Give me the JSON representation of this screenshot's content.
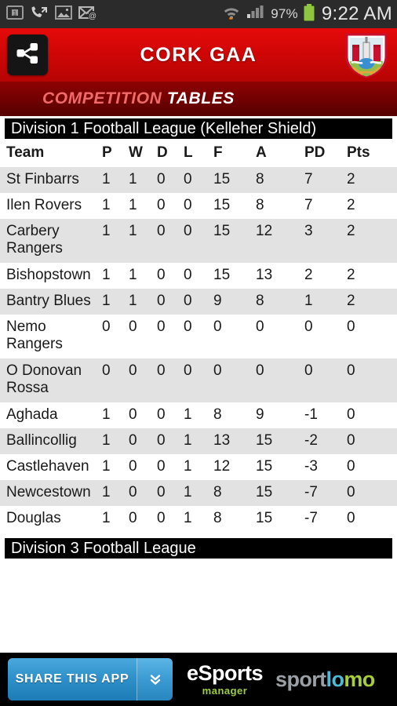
{
  "statusbar": {
    "icons": [
      "sim-card-icon",
      "missed-call-icon",
      "screenshot-icon",
      "email-icon"
    ],
    "wifi_icon": "wifi-icon",
    "signal_icon": "cell-signal-icon",
    "battery_percent": "97%",
    "battery_icon": "battery-full-icon",
    "clock": "9:22 AM"
  },
  "appbar": {
    "share_icon": "share-icon",
    "title": "CORK GAA",
    "crest_icon": "cork-gaa-crest-icon",
    "background_color": "#cf0606"
  },
  "subbar": {
    "word1": "COMPETITION",
    "word2": "TABLES",
    "word1_color": "#f06a6a",
    "word2_color": "#ffffff"
  },
  "table": {
    "division_title": "Division 1 Football League (Kelleher Shield)",
    "columns": [
      "Team",
      "P",
      "W",
      "D",
      "L",
      "F",
      "A",
      "PD",
      "Pts"
    ],
    "rows": [
      {
        "team": "St Finbarrs",
        "p": "1",
        "w": "1",
        "d": "0",
        "l": "0",
        "f": "15",
        "a": "8",
        "pd": "7",
        "pts": "2"
      },
      {
        "team": "Ilen Rovers",
        "p": "1",
        "w": "1",
        "d": "0",
        "l": "0",
        "f": "15",
        "a": "8",
        "pd": "7",
        "pts": "2"
      },
      {
        "team": "Carbery Rangers",
        "p": "1",
        "w": "1",
        "d": "0",
        "l": "0",
        "f": "15",
        "a": "12",
        "pd": "3",
        "pts": "2"
      },
      {
        "team": "Bishopstown",
        "p": "1",
        "w": "1",
        "d": "0",
        "l": "0",
        "f": "15",
        "a": "13",
        "pd": "2",
        "pts": "2"
      },
      {
        "team": "Bantry Blues",
        "p": "1",
        "w": "1",
        "d": "0",
        "l": "0",
        "f": "9",
        "a": "8",
        "pd": "1",
        "pts": "2"
      },
      {
        "team": "Nemo Rangers",
        "p": "0",
        "w": "0",
        "d": "0",
        "l": "0",
        "f": "0",
        "a": "0",
        "pd": "0",
        "pts": "0"
      },
      {
        "team": "O Donovan Rossa",
        "p": "0",
        "w": "0",
        "d": "0",
        "l": "0",
        "f": "0",
        "a": "0",
        "pd": "0",
        "pts": "0"
      },
      {
        "team": "Aghada",
        "p": "1",
        "w": "0",
        "d": "0",
        "l": "1",
        "f": "8",
        "a": "9",
        "pd": "-1",
        "pts": "0"
      },
      {
        "team": "Ballincollig",
        "p": "1",
        "w": "0",
        "d": "0",
        "l": "1",
        "f": "13",
        "a": "15",
        "pd": "-2",
        "pts": "0"
      },
      {
        "team": "Castlehaven",
        "p": "1",
        "w": "0",
        "d": "0",
        "l": "1",
        "f": "12",
        "a": "15",
        "pd": "-3",
        "pts": "0"
      },
      {
        "team": "Newcestown",
        "p": "1",
        "w": "0",
        "d": "0",
        "l": "1",
        "f": "8",
        "a": "15",
        "pd": "-7",
        "pts": "0"
      },
      {
        "team": "Douglas",
        "p": "1",
        "w": "0",
        "d": "0",
        "l": "1",
        "f": "8",
        "a": "15",
        "pd": "-7",
        "pts": "0"
      }
    ]
  },
  "next_division": {
    "title": "Division 3 Football League"
  },
  "adbar": {
    "share_app_label": "SHARE THIS APP",
    "share_app_caret_icon": "double-chevron-down-icon",
    "esports_main": "eSports",
    "esports_sub": "manager",
    "sportlomo_part1": "sport",
    "sportlomo_part2": "lo",
    "sportlomo_part3": "mo"
  }
}
